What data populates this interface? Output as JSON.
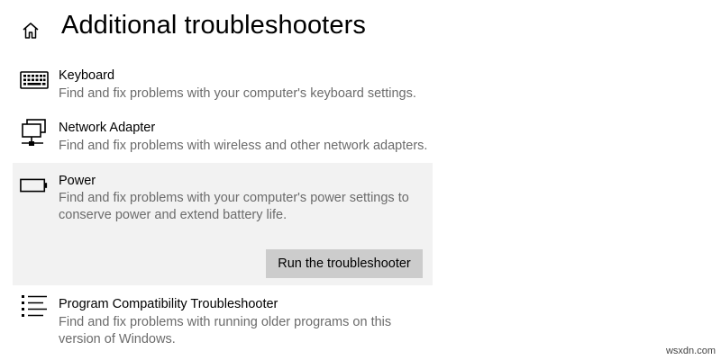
{
  "header": {
    "title": "Additional troubleshooters",
    "home_icon": "home-icon"
  },
  "items": [
    {
      "icon": "keyboard-icon",
      "name": "Keyboard",
      "description": "Find and fix problems with your computer's keyboard settings."
    },
    {
      "icon": "network-adapter-icon",
      "name": "Network Adapter",
      "description": "Find and fix problems with wireless and other network adapters."
    },
    {
      "icon": "battery-icon",
      "name": "Power",
      "description": "Find and fix problems with your computer's power settings to conserve power and extend battery life.",
      "button_label": "Run the troubleshooter",
      "selected": true
    },
    {
      "icon": "list-icon",
      "name": "Program Compatibility Troubleshooter",
      "description": "Find and fix problems with running older programs on this version of Windows."
    }
  ],
  "watermark": "wsxdn.com",
  "colors": {
    "selected_background": "#f2f2f2",
    "button_background": "#cccccc",
    "description_text": "#6b6b6b"
  }
}
